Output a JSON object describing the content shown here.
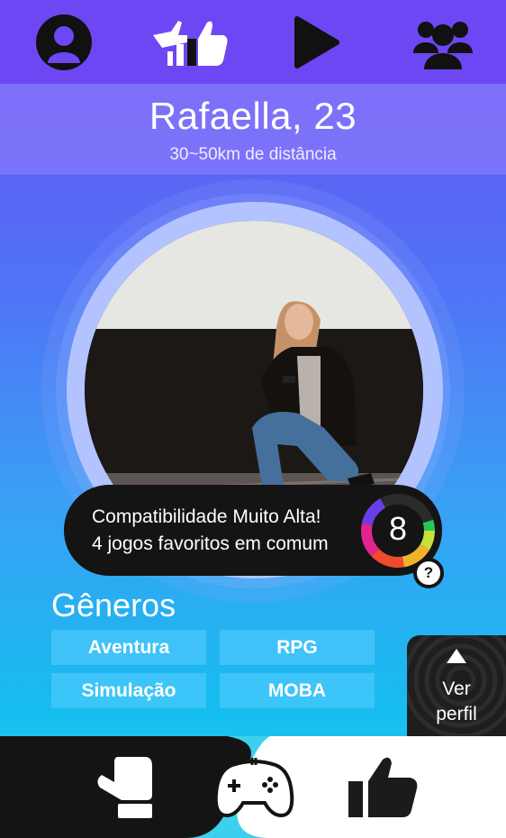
{
  "topbar": {
    "icons": [
      "user-profile-icon",
      "thumbs-like-icon",
      "play-icon",
      "group-icon"
    ]
  },
  "profile": {
    "name_age": "Rafaella, 23",
    "distance": "30~50km de distância"
  },
  "compatibility": {
    "title": "Compatibilidade Muito Alta!",
    "common_games": "4 jogos favoritos em comum",
    "score": "8",
    "help": "?"
  },
  "genres": {
    "title": "Gêneros",
    "items": [
      "Aventura",
      "RPG",
      "Simulação",
      "MOBA"
    ]
  },
  "view_profile": {
    "label_line1": "Ver",
    "label_line2": "perfil"
  },
  "bottombar": {
    "icons": [
      "glove-icon",
      "gamepad-icon",
      "thumbs-up-icon"
    ]
  },
  "colors": {
    "topbar": "#6d47f4",
    "dark": "#141414",
    "genre_chip": "#5acdff"
  }
}
